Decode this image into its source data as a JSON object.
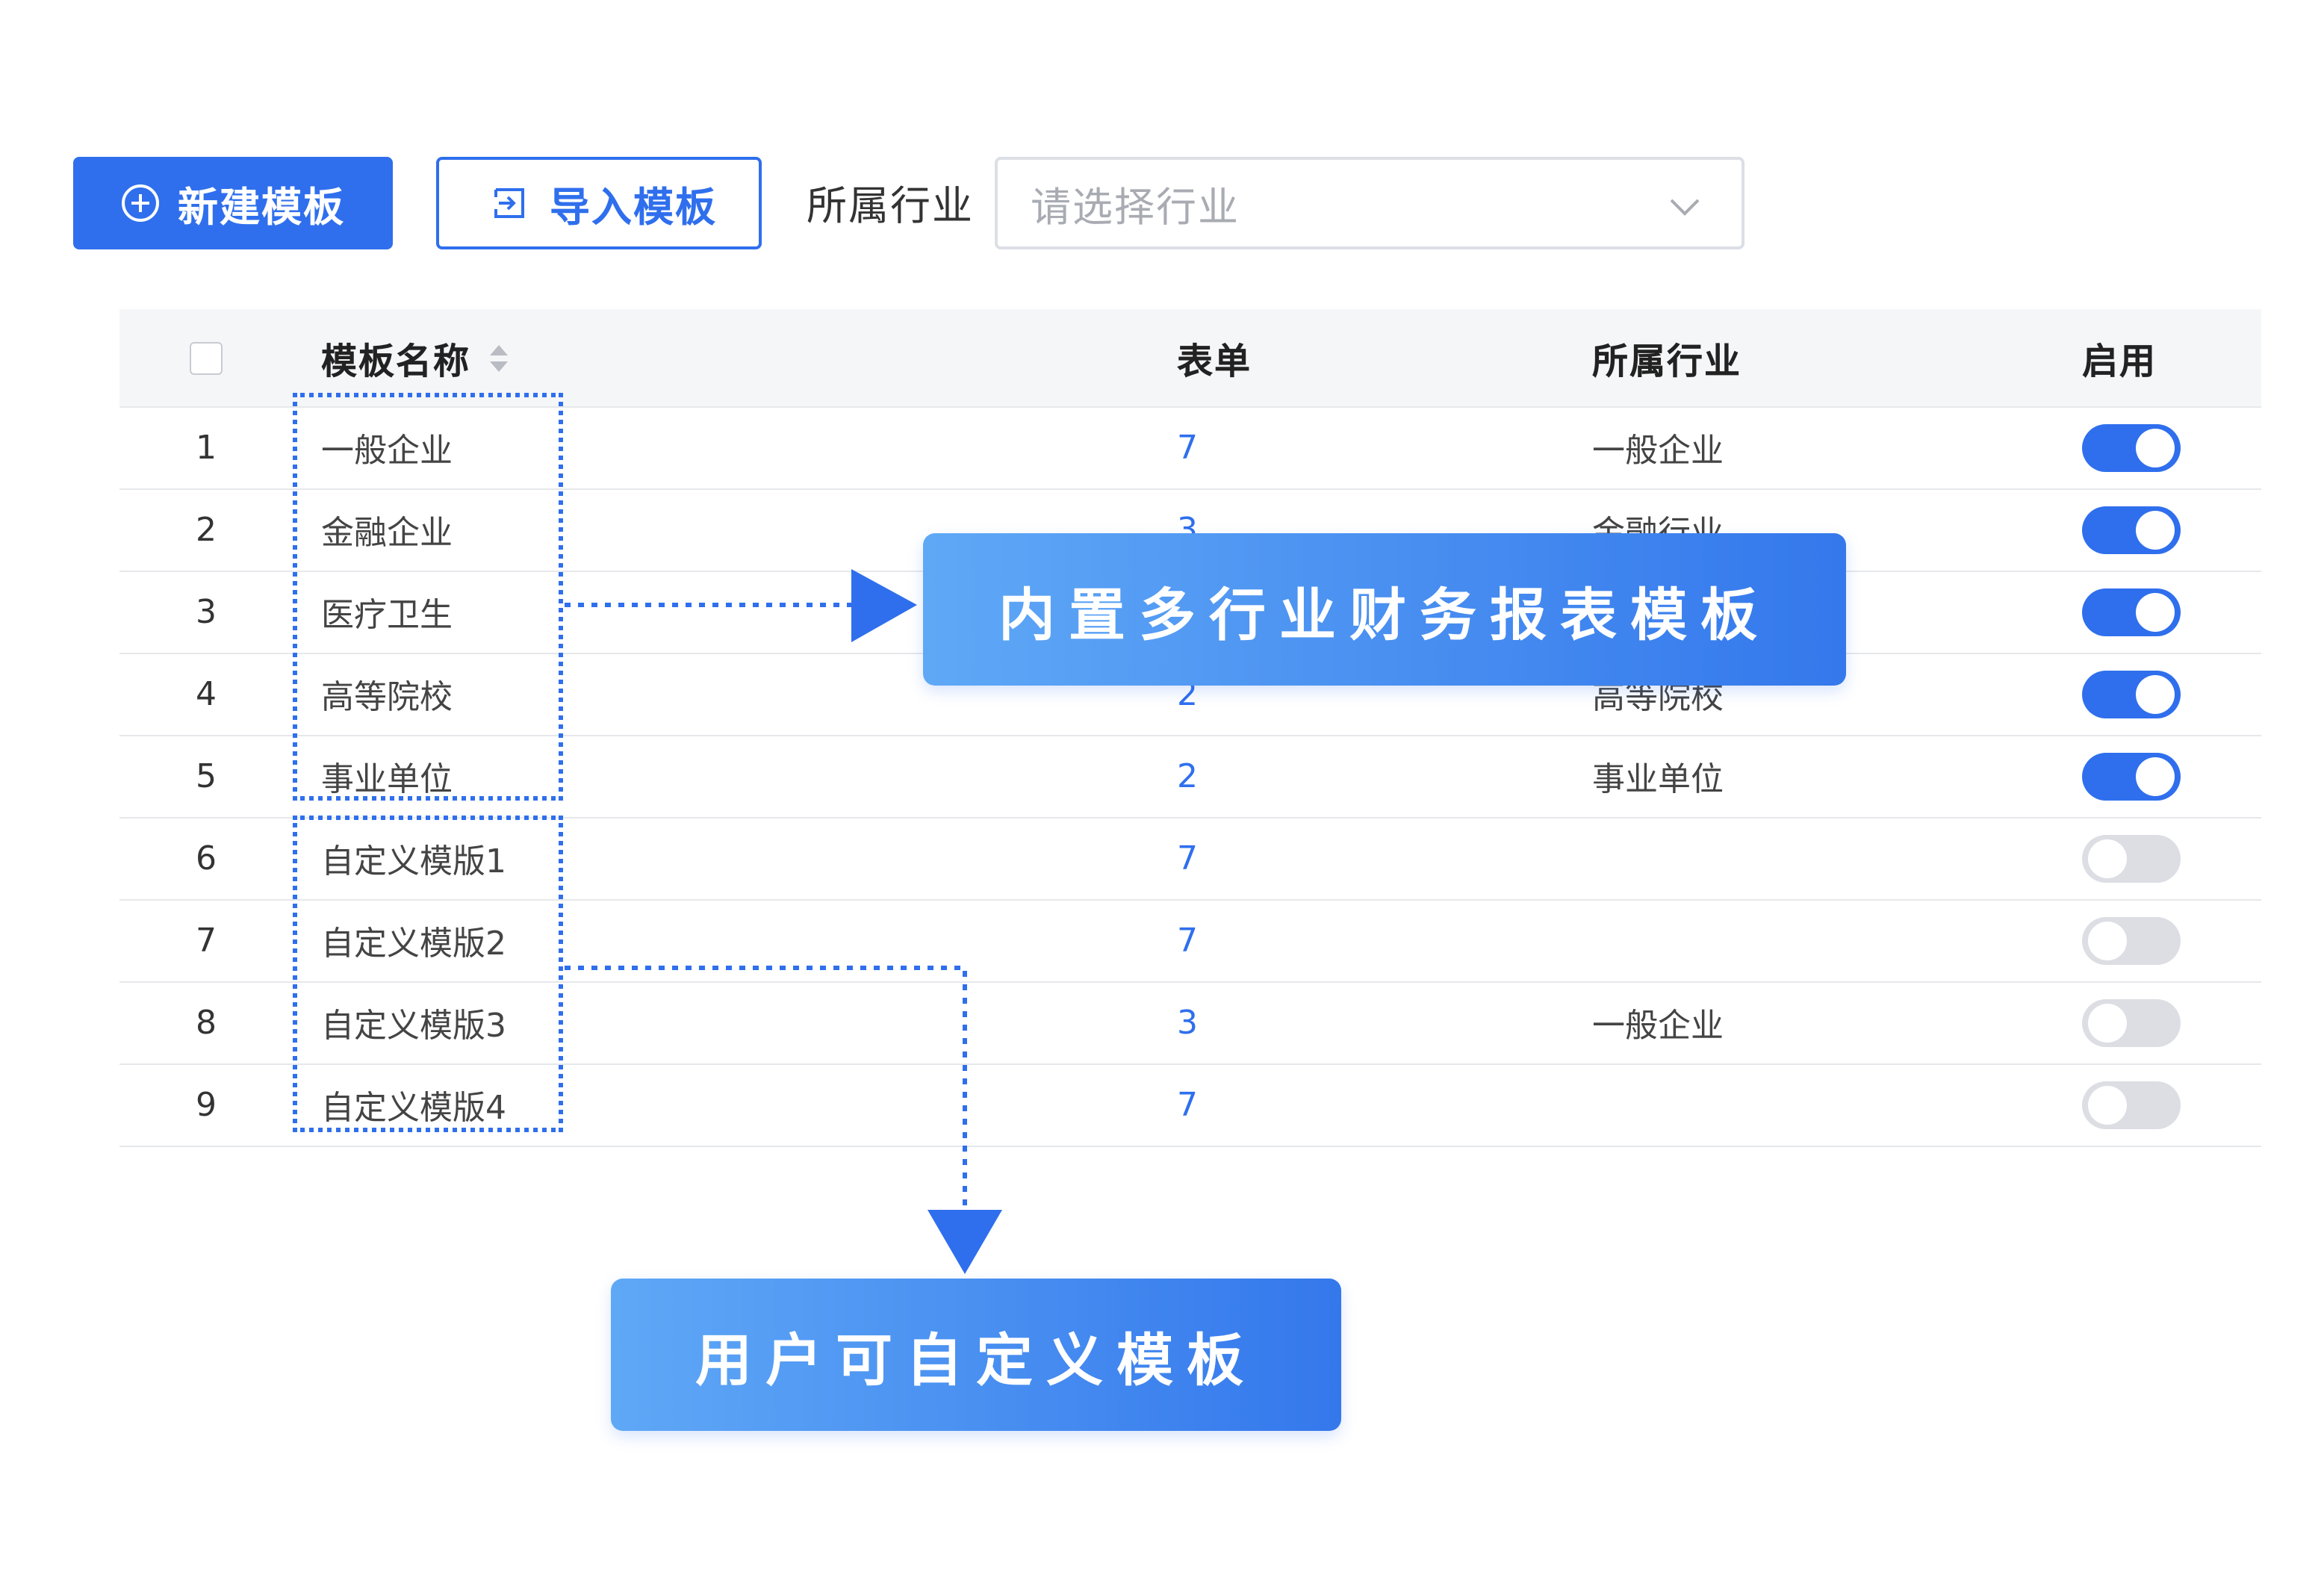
{
  "toolbar": {
    "new_template_label": "新建模板",
    "import_template_label": "导入模板",
    "industry_label": "所属行业",
    "industry_select_placeholder": "请选择行业"
  },
  "table": {
    "columns": {
      "name": "模板名称",
      "form": "表单",
      "industry": "所属行业",
      "enabled": "启用"
    },
    "rows": [
      {
        "index": "1",
        "name": "一般企业",
        "form": "7",
        "industry": "一般企业",
        "enabled": true
      },
      {
        "index": "2",
        "name": "金融企业",
        "form": "3",
        "industry": "金融行业",
        "enabled": true
      },
      {
        "index": "3",
        "name": "医疗卫生",
        "form": "",
        "industry": "",
        "enabled": true
      },
      {
        "index": "4",
        "name": "高等院校",
        "form": "2",
        "industry": "高等院校",
        "enabled": true
      },
      {
        "index": "5",
        "name": "事业单位",
        "form": "2",
        "industry": "事业单位",
        "enabled": true
      },
      {
        "index": "6",
        "name": "自定义模版1",
        "form": "7",
        "industry": "",
        "enabled": false
      },
      {
        "index": "7",
        "name": "自定义模版2",
        "form": "7",
        "industry": "",
        "enabled": false
      },
      {
        "index": "8",
        "name": "自定义模版3",
        "form": "3",
        "industry": "一般企业",
        "enabled": false
      },
      {
        "index": "9",
        "name": "自定义模版4",
        "form": "7",
        "industry": "",
        "enabled": false
      }
    ]
  },
  "annotations": {
    "builtin_callout": "内置多行业财务报表模板",
    "custom_callout": "用户可自定义模板"
  },
  "colors": {
    "accent": "#2f6fed",
    "toggle_off": "#dcdee3",
    "callout_gradient_start": "#5fa8f6",
    "callout_gradient_end": "#3478ec"
  },
  "icons": {
    "new_button": "plus-circle-icon",
    "import_button": "import-icon",
    "select": "chevron-down-icon",
    "sort": "sort-icon"
  }
}
